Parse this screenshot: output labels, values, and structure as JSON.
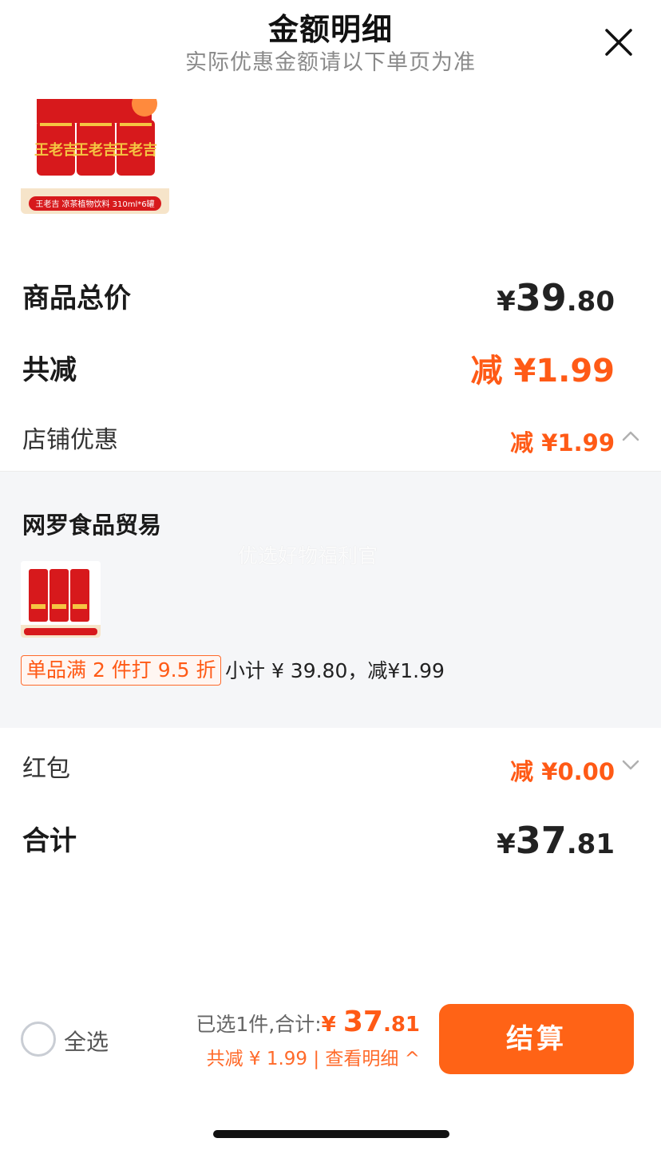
{
  "header": {
    "title": "金额明细",
    "subtitle": "实际优惠金额请以下单页为准",
    "close_icon": "close-icon"
  },
  "product": {
    "image_caption": "王老吉 凉茶植物饮料 310ml*6罐",
    "brand_text": "王老吉"
  },
  "summary": {
    "goods_total_label": "商品总价",
    "goods_total": {
      "yen": "¥",
      "int": "39",
      "dec": ".80"
    },
    "total_discount_label": "共减",
    "total_discount": "减 ¥1.99",
    "shop_discount_label": "店铺优惠",
    "shop_discount": "减 ¥1.99",
    "red_packet_label": "红包",
    "red_packet": "减 ¥0.00",
    "sum_label": "合计",
    "sum": {
      "yen": "¥",
      "int": "37",
      "dec": ".81"
    }
  },
  "shop": {
    "name": "网罗食品贸易",
    "watermark": "优选好物福利官",
    "promo_tag": "单品满 2 件打 9.5 折",
    "promo_text": "小计 ¥ 39.80，减¥1.99",
    "thumb_caption": "王老吉 凉茶植物饮料 310ml*6罐"
  },
  "bottom_bar": {
    "select_all": "全选",
    "selected_prefix": "已选1件,合计:",
    "amount": {
      "yen": "¥ ",
      "int": "37",
      "dec": ".81"
    },
    "discount_line": "共减 ¥ 1.99 | 查看明细 ^",
    "checkout": "结算"
  },
  "colors": {
    "accent": "#ff5a16",
    "checkout_bg": "#ff6316",
    "panel_bg": "#f5f6f8"
  }
}
